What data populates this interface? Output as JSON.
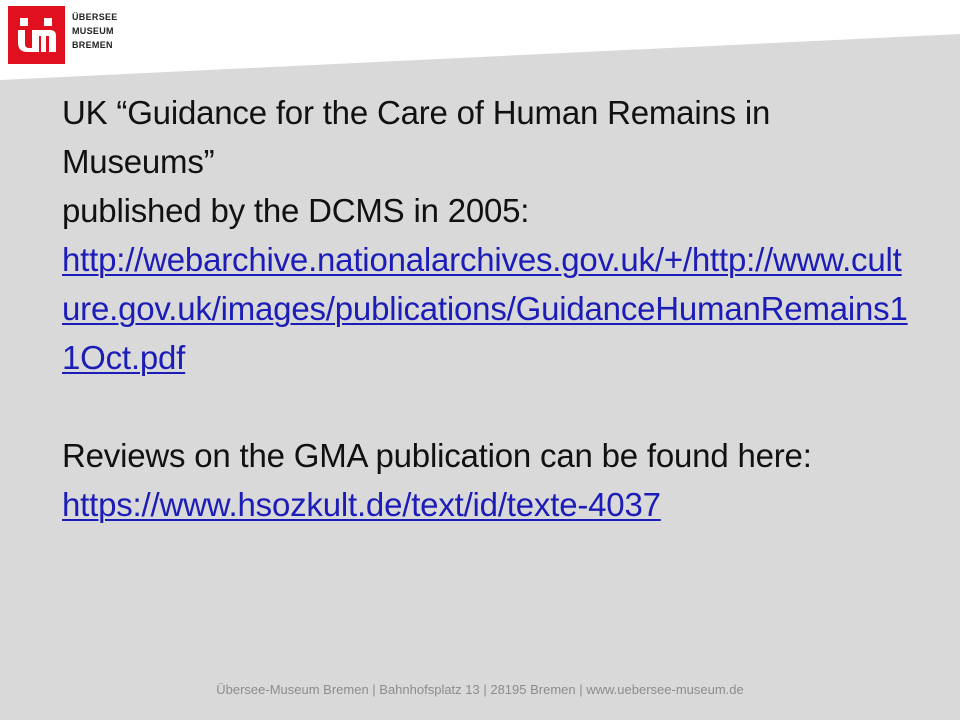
{
  "logo": {
    "line1": "ÜBERSEE",
    "line2": "MUSEUM",
    "line3": "BREMEN"
  },
  "content": {
    "heading_line1": "UK “Guidance for the Care of Human Remains in Museums”",
    "heading_line2": "published by the DCMS in 2005:",
    "link1": "http://webarchive.nationalarchives.gov.uk/+/http://www.culture.gov.uk/images/publications/GuidanceHumanRemains11Oct.pdf",
    "reviews_text": "Reviews on the GMA publication can be found here:",
    "link2": "https://www.hsozkult.de/text/id/texte-4037"
  },
  "footer": {
    "text": "Übersee-Museum Bremen | Bahnhofsplatz 13 | 28195 Bremen | www.uebersee-museum.de"
  },
  "colors": {
    "background": "#d9d9d9",
    "brand_red": "#e0101e",
    "link_blue": "#1c1cb8"
  }
}
